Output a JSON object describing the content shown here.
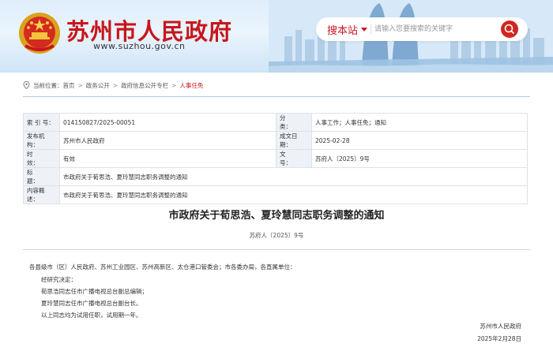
{
  "header": {
    "site_title": "苏州市人民政府",
    "site_url": "www.suzhou.gov.cn",
    "search_scope": "搜本站",
    "search_placeholder": "请输入您要搜索的关键字",
    "icons": {
      "emblem": "national-emblem-icon",
      "location": "location-pin-icon",
      "search": "search-icon"
    },
    "colors": {
      "brand": "#c8161d"
    }
  },
  "breadcrumb": {
    "label": "当前位置：",
    "items": [
      "首页",
      "政务公开",
      "政府信息公开专栏",
      "人事任免"
    ]
  },
  "info": {
    "index_key": "索 引 号：",
    "index_val": "014150827/2025-00051",
    "category_key": "分　　类：",
    "category_val": "人事工作；人事任免；通知",
    "publisher_key": "发布机构：",
    "publisher_val": "苏州市人民政府",
    "date_key": "成文日期：",
    "date_val": "2025-02-28",
    "validity_key": "时　　效：",
    "validity_val": "有效",
    "docno_key": "文　　号：",
    "docno_val": "苏府人〔2025〕9号",
    "title_key": "标　　题：",
    "title_val": "市政府关于荀思浩、夏玲慧同志职务调整的通知",
    "summary_key": "内容概述：",
    "summary_val": "市政府关于荀思浩、夏玲慧同志职务调整的通知"
  },
  "doc": {
    "title": "市政府关于荀思浩、夏玲慧同志职务调整的通知",
    "number": "苏府人〔2025〕9号",
    "paragraphs": [
      "各县级市（区）人民政府、苏州工业园区、苏州高新区、太仓港口管委会；市各委办局，各直属单位：",
      "经研究决定：",
      "荀思浩同志任市广播电视总台副总编辑；",
      "夏玲慧同志任市广播电视总台副台长。",
      "以上同志均为试用任职，试用期一年。"
    ],
    "signature": "苏州市人民政府",
    "date": "2025年2月28日"
  }
}
